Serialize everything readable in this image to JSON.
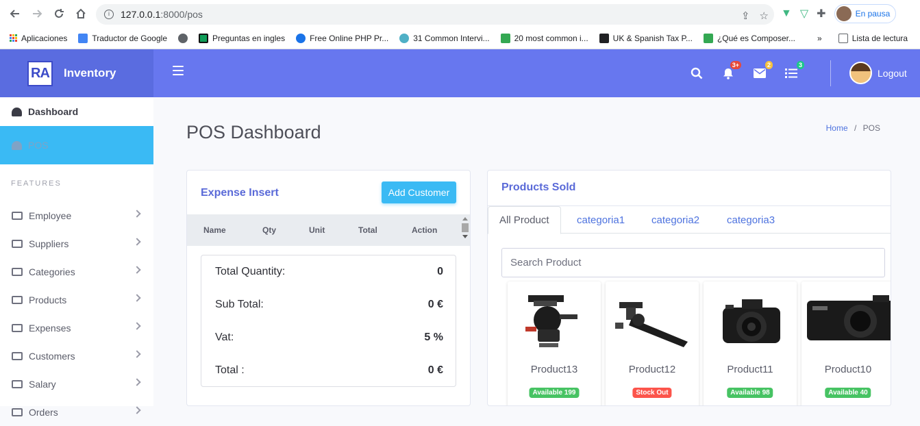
{
  "browser": {
    "url_host": "127.0.0.1",
    "url_path": ":8000/pos",
    "profile_status": "En pausa",
    "bookmarks": [
      {
        "label": "Aplicaciones",
        "color": "#ea4335"
      },
      {
        "label": "Traductor de Google",
        "color": "#4285f4"
      },
      {
        "label": "",
        "color": "#5f6368"
      },
      {
        "label": "Preguntas en ingles",
        "color": "#0f9d58"
      },
      {
        "label": "Free Online PHP Pr...",
        "color": "#1a73e8"
      },
      {
        "label": "31 Common Intervi...",
        "color": "#4fb0c6"
      },
      {
        "label": "20 most common i...",
        "color": "#34a853"
      },
      {
        "label": "UK & Spanish Tax P...",
        "color": "#202124"
      },
      {
        "label": "¿Qué es Composer...",
        "color": "#34a853"
      }
    ],
    "more_label": "»",
    "reading_list": "Lista de lectura"
  },
  "app": {
    "brand_logo": "RA",
    "brand_name": "Inventory",
    "notifications_badge": "3+",
    "messages_badge": "2",
    "tasks_badge": "3",
    "logout_label": "Logout"
  },
  "sidebar": {
    "dashboard": "Dashboard",
    "pos": "POS",
    "section_label": "FEATURES",
    "items": [
      {
        "label": "Employee"
      },
      {
        "label": "Suppliers"
      },
      {
        "label": "Categories"
      },
      {
        "label": "Products"
      },
      {
        "label": "Expenses"
      },
      {
        "label": "Customers"
      },
      {
        "label": "Salary"
      },
      {
        "label": "Orders"
      }
    ]
  },
  "page": {
    "title": "POS Dashboard",
    "breadcrumb_home": "Home",
    "breadcrumb_sep": "/",
    "breadcrumb_current": "POS"
  },
  "expense": {
    "title": "Expense Insert",
    "add_customer": "Add Customer",
    "columns": [
      "Name",
      "Qty",
      "Unit",
      "Total",
      "Action"
    ],
    "total_quantity_label": "Total Quantity:",
    "total_quantity_value": "0",
    "sub_total_label": "Sub Total:",
    "sub_total_value": "0 €",
    "vat_label": "Vat:",
    "vat_value": "5 %",
    "total_label": "Total :",
    "total_value": "0 €"
  },
  "products": {
    "title": "Products Sold",
    "tabs": [
      "All Product",
      "categoria1",
      "categoria2",
      "categoria3"
    ],
    "search_placeholder": "Search Product",
    "items": [
      {
        "name": "Product13",
        "status": "Available 199",
        "status_color": "#47c363"
      },
      {
        "name": "Product12",
        "status": "Stock Out",
        "status_color": "#fc544b"
      },
      {
        "name": "Product11",
        "status": "Available 98",
        "status_color": "#47c363"
      },
      {
        "name": "Product10",
        "status": "Available 40",
        "status_color": "#47c363"
      }
    ]
  },
  "colors": {
    "primary": "#6777ef",
    "info": "#3abaf4",
    "success": "#47c363",
    "danger": "#fc544b"
  }
}
